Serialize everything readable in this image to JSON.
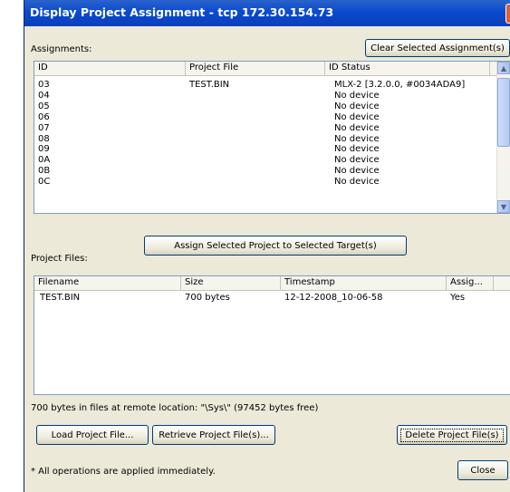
{
  "window": {
    "title": "Display Project Assignment - tcp 172.30.154.73"
  },
  "assignments": {
    "label": "Assignments:",
    "clear_button": "Clear Selected Assignment(s)",
    "columns": [
      "ID",
      "Project File",
      "ID Status"
    ],
    "rows": [
      {
        "id": "03",
        "file": "TEST.BIN",
        "status": "MLX-2 [3.2.0.0, #0034ADA9]"
      },
      {
        "id": "04",
        "file": "",
        "status": "No device"
      },
      {
        "id": "05",
        "file": "",
        "status": "No device"
      },
      {
        "id": "06",
        "file": "",
        "status": "No device"
      },
      {
        "id": "07",
        "file": "",
        "status": "No device"
      },
      {
        "id": "08",
        "file": "",
        "status": "No device"
      },
      {
        "id": "09",
        "file": "",
        "status": "No device"
      },
      {
        "id": "0A",
        "file": "",
        "status": "No device"
      },
      {
        "id": "0B",
        "file": "",
        "status": "No device"
      },
      {
        "id": "0C",
        "file": "",
        "status": "No device"
      }
    ]
  },
  "assign_button": "Assign Selected Project to Selected Target(s)",
  "project_files": {
    "label": "Project Files:",
    "columns": [
      "Filename",
      "Size",
      "Timestamp",
      "Assig..."
    ],
    "rows": [
      {
        "filename": "TEST.BIN",
        "size": "700 bytes",
        "timestamp": "12-12-2008_10-06-58",
        "assigned": "Yes"
      }
    ]
  },
  "status_text": "700 bytes in files at remote location: \"\\Sys\\\" (97452 bytes free)",
  "buttons": {
    "load": "Load Project File...",
    "retrieve": "Retrieve Project File(s)...",
    "delete": "Delete Project File(s)",
    "close": "Close"
  },
  "footnote": "* All operations are applied immediately.",
  "colors": {
    "titlebar": "#0a4ad0",
    "dialog": "#ece9d8",
    "list_border": "#7f9db9"
  },
  "icons": {
    "scroll_up": "chevron-up-icon",
    "scroll_down": "chevron-down-icon"
  }
}
